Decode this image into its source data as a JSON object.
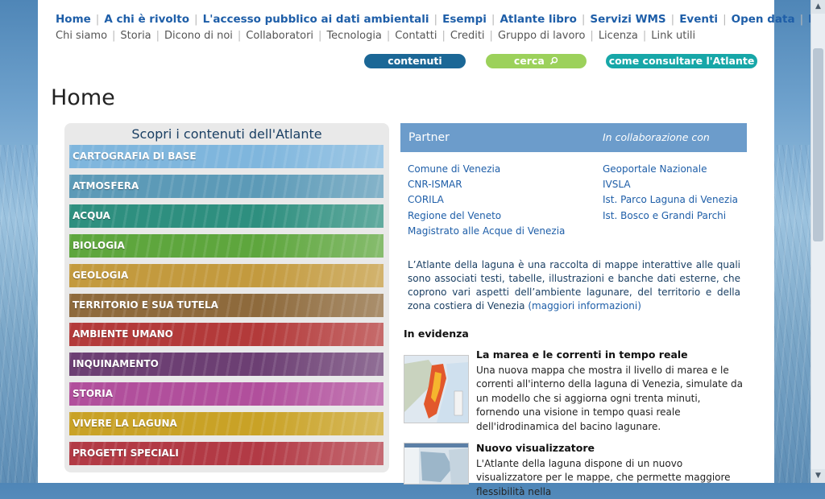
{
  "nav_primary": [
    "Home",
    "A chi è rivolto",
    "L'accesso pubblico ai dati ambientali",
    "Esempi",
    "Atlante libro",
    "Servizi WMS",
    "Eventi",
    "Open data",
    "HELP"
  ],
  "nav_secondary": [
    "Chi siamo",
    "Storia",
    "Dicono di noi",
    "Collaboratori",
    "Tecnologia",
    "Contatti",
    "Crediti",
    "Gruppo di lavoro",
    "Licenza",
    "Link utili"
  ],
  "buttons": {
    "contenuti": "contenuti",
    "cerca": "cerca",
    "cerca_icon": "search-icon",
    "consultare": "come consultare l'Atlante"
  },
  "page_title": "Home",
  "left_panel": {
    "heading": "Scopri i contenuti dell'Atlante",
    "categories": [
      {
        "label": "CARTOGRAFIA DI BASE",
        "color": "#7fb6dd"
      },
      {
        "label": "ATMOSFERA",
        "color": "#5c9ab7"
      },
      {
        "label": "ACQUA",
        "color": "#2e8f7f"
      },
      {
        "label": "BIOLOGIA",
        "color": "#5ea63d"
      },
      {
        "label": "GEOLOGIA",
        "color": "#c39a3e"
      },
      {
        "label": "TERRITORIO E SUA TUTELA",
        "color": "#8e6a3c"
      },
      {
        "label": "AMBIENTE UMANO",
        "color": "#b33a3a"
      },
      {
        "label": "INQUINAMENTO",
        "color": "#6c3f73"
      },
      {
        "label": "STORIA",
        "color": "#b14f9c"
      },
      {
        "label": "VIVERE LA LAGUNA",
        "color": "#c9a226"
      },
      {
        "label": "PROGETTI SPECIALI",
        "color": "#b23a45"
      }
    ]
  },
  "partner": {
    "title": "Partner",
    "collab_title": "In collaborazione con",
    "partners": [
      "Comune di Venezia",
      "CNR-ISMAR",
      "CORILA",
      "Regione del Veneto",
      "Magistrato alle Acque di  Venezia"
    ],
    "collaborators": [
      "Geoportale Nazionale",
      "IVSLA",
      "Ist. Parco Laguna di Venezia",
      "Ist. Bosco e Grandi Parchi"
    ]
  },
  "intro": {
    "text": "L’Atlante della laguna è una raccolta di mappe interattive alle quali sono associati testi, tabelle, illustrazioni e banche dati esterne, che coprono vari aspetti dell’ambiente lagunare, del territorio e della zona costiera di Venezia ",
    "link": "(maggiori informazioni)"
  },
  "evidenza": {
    "heading": "In evidenza",
    "items": [
      {
        "title": "La marea e le correnti in tempo reale",
        "text": "Una nuova mappa che mostra il livello di marea e le correnti all'interno della laguna di Venezia, simulate da un modello che si aggiorna ogni trenta minuti, fornendo una visione in tempo quasi reale dell'idrodinamica del bacino lagunare."
      },
      {
        "title": "Nuovo visualizzatore",
        "text": "L'Atlante della laguna dispone di un nuovo visualizzatore per le mappe, che permette maggiore flessibilità nella"
      }
    ]
  }
}
